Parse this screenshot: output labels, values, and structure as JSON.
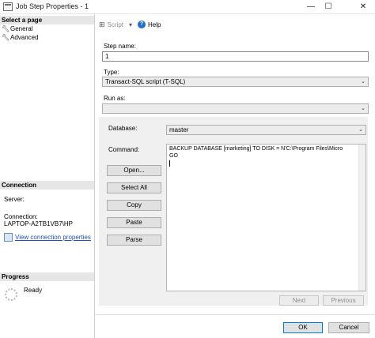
{
  "window": {
    "title": "Job Step Properties - 1",
    "minimize_glyph": "—",
    "maximize_glyph": "☐",
    "close_glyph": "✕"
  },
  "left_pane": {
    "select_page_header": "Select a page",
    "pages": [
      {
        "label": "General",
        "icon": "wrench-icon"
      },
      {
        "label": "Advanced",
        "icon": "wrench-icon"
      }
    ],
    "connection_header": "Connection",
    "server_label": "Server:",
    "server_value": "",
    "connection_label": "Connection:",
    "connection_value": "LAPTOP-A2TB1VB7\\HP",
    "view_connection_link": "View connection properties",
    "progress_header": "Progress",
    "progress_status": "Ready"
  },
  "toolbar": {
    "script_label": "Script",
    "help_label": "Help"
  },
  "form": {
    "step_name_label": "Step name:",
    "step_name_value": "1",
    "type_label": "Type:",
    "type_value": "Transact-SQL script (T-SQL)",
    "run_as_label": "Run as:",
    "run_as_value": "",
    "database_label": "Database:",
    "database_value": "master",
    "command_label": "Command:",
    "command_lines": [
      "BACKUP DATABASE [marketing] TO  DISK = N'C:\\Program Files\\Micro",
      "GO"
    ]
  },
  "command_buttons": {
    "open": "Open...",
    "select_all": "Select All",
    "copy": "Copy",
    "paste": "Paste",
    "parse": "Parse"
  },
  "nav_buttons": {
    "next": "Next",
    "previous": "Previous"
  },
  "dialog_buttons": {
    "ok": "OK",
    "cancel": "Cancel"
  }
}
